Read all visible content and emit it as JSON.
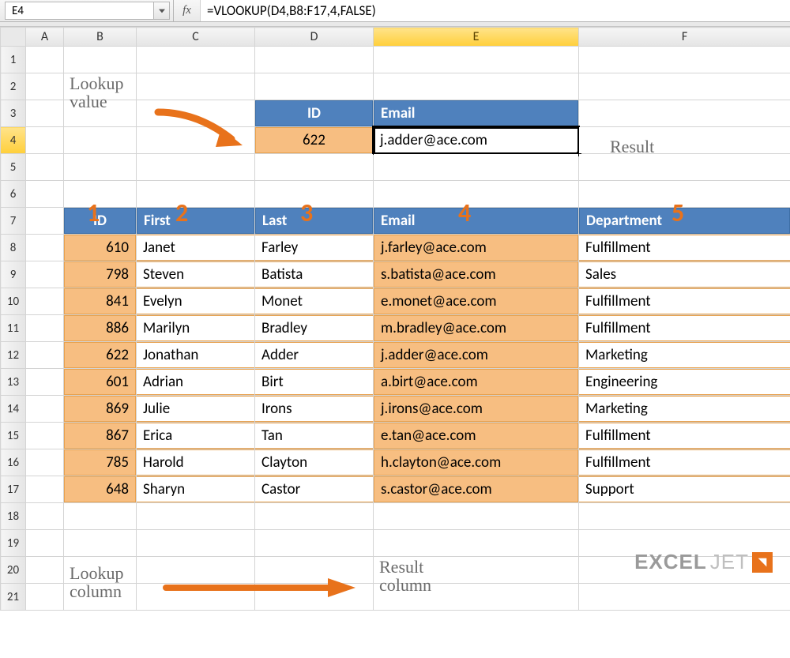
{
  "namebox": {
    "cell_ref": "E4"
  },
  "formula_bar": {
    "fx_label": "fx",
    "formula": "=VLOOKUP(D4,B8:F17,4,FALSE)"
  },
  "column_headers": [
    "A",
    "B",
    "C",
    "D",
    "E",
    "F"
  ],
  "row_headers": [
    "1",
    "2",
    "3",
    "4",
    "5",
    "6",
    "7",
    "8",
    "9",
    "10",
    "11",
    "12",
    "13",
    "14",
    "15",
    "16",
    "17",
    "18",
    "19",
    "20",
    "21"
  ],
  "lookup_box": {
    "headers": {
      "id": "ID",
      "email": "Email"
    },
    "values": {
      "id": "622",
      "email": "j.adder@ace.com"
    }
  },
  "column_numbers": [
    "1",
    "2",
    "3",
    "4",
    "5"
  ],
  "data_table": {
    "headers": {
      "id": "ID",
      "first": "First",
      "last": "Last",
      "email": "Email",
      "dept": "Department"
    },
    "rows": [
      {
        "id": "610",
        "first": "Janet",
        "last": "Farley",
        "email": "j.farley@ace.com",
        "dept": "Fulfillment"
      },
      {
        "id": "798",
        "first": "Steven",
        "last": "Batista",
        "email": "s.batista@ace.com",
        "dept": "Sales"
      },
      {
        "id": "841",
        "first": "Evelyn",
        "last": "Monet",
        "email": "e.monet@ace.com",
        "dept": "Fulfillment"
      },
      {
        "id": "886",
        "first": "Marilyn",
        "last": "Bradley",
        "email": "m.bradley@ace.com",
        "dept": "Fulfillment"
      },
      {
        "id": "622",
        "first": "Jonathan",
        "last": "Adder",
        "email": "j.adder@ace.com",
        "dept": "Marketing"
      },
      {
        "id": "601",
        "first": "Adrian",
        "last": "Birt",
        "email": "a.birt@ace.com",
        "dept": "Engineering"
      },
      {
        "id": "869",
        "first": "Julie",
        "last": "Irons",
        "email": "j.irons@ace.com",
        "dept": "Marketing"
      },
      {
        "id": "867",
        "first": "Erica",
        "last": "Tan",
        "email": "e.tan@ace.com",
        "dept": "Fulfillment"
      },
      {
        "id": "785",
        "first": "Harold",
        "last": "Clayton",
        "email": "h.clayton@ace.com",
        "dept": "Fulfillment"
      },
      {
        "id": "648",
        "first": "Sharyn",
        "last": "Castor",
        "email": "s.castor@ace.com",
        "dept": "Support"
      }
    ]
  },
  "annotations": {
    "lookup_value_line1": "Lookup",
    "lookup_value_line2": "value",
    "result": "Result",
    "lookup_col_line1": "Lookup",
    "lookup_col_line2": "column",
    "result_col_line1": "Result",
    "result_col_line2": "column"
  },
  "logo": {
    "part1": "EXCEL",
    "part2": "JET"
  }
}
